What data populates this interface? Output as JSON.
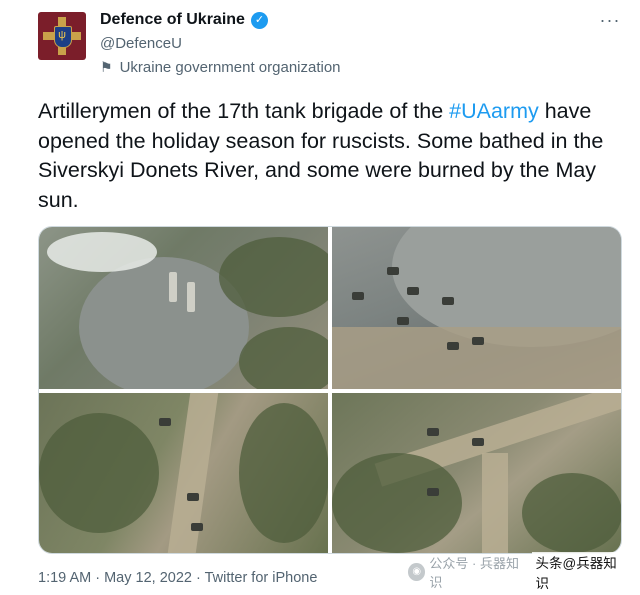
{
  "account": {
    "name": "Defence of Ukraine",
    "handle": "@DefenceU",
    "organization_label": "Ukraine government organization",
    "verified_color": "#1d9bf0"
  },
  "tweet": {
    "text_before": "Artillerymen of the 17th tank brigade of the ",
    "hashtag": "#UAarmy",
    "text_after": " have opened the holiday season for ruscists. Some bathed in the Siverskyi Donets River, and some were burned by the May sun.",
    "hashtag_color": "#1d9bf0"
  },
  "media": {
    "photo_count": 4
  },
  "footer": {
    "timestamp": "1:19 AM · May 12, 2022 · Twitter for iPhone"
  },
  "watermark": {
    "source_label": "公众号 · 兵器知识",
    "overlay_label": "头条@兵器知识"
  },
  "icons": {
    "avatar": "ukraine-defence-emblem-icon",
    "verified": "verified-badge-icon",
    "organization": "flag-icon",
    "more": "more-options-icon",
    "watermark": "wechat-icon"
  }
}
